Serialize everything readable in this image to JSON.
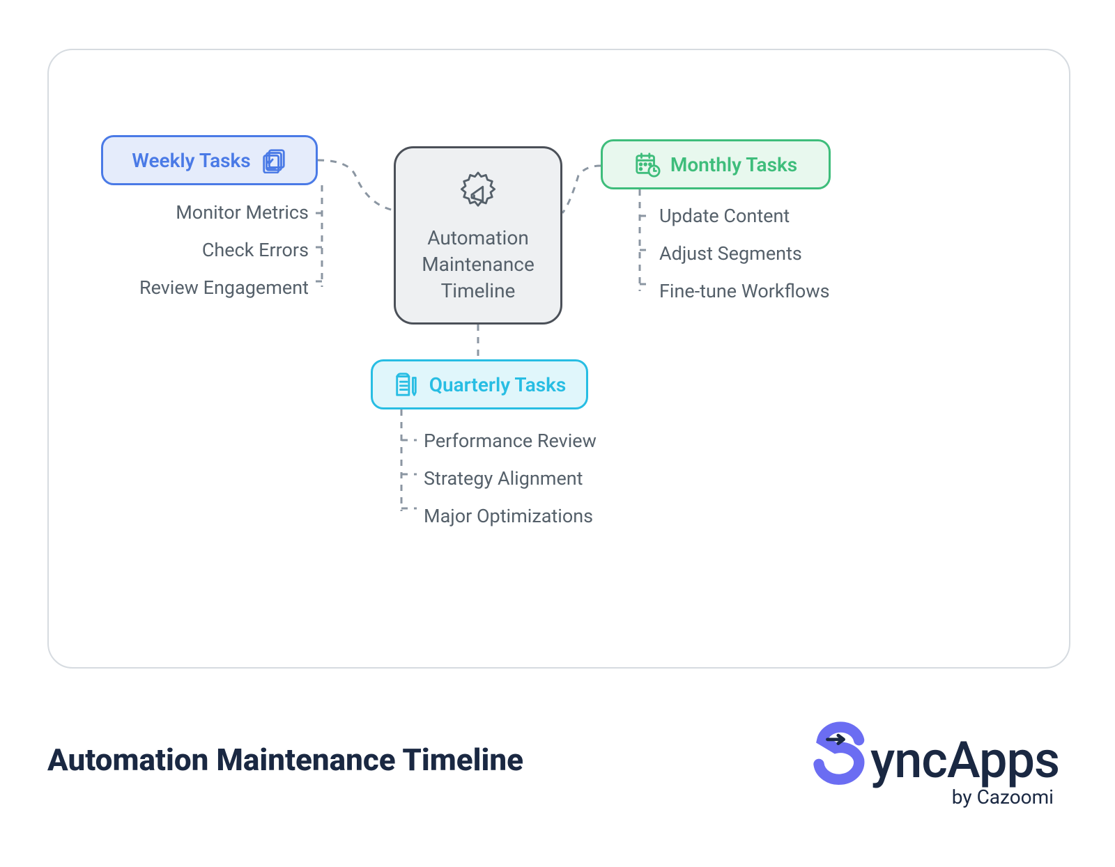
{
  "center": {
    "label": "Automation\nMaintenance\nTimeline"
  },
  "weekly": {
    "title": "Weekly Tasks",
    "items": [
      "Monitor Metrics",
      "Check Errors",
      "Review Engagement"
    ]
  },
  "monthly": {
    "title": "Monthly Tasks",
    "items": [
      "Update Content",
      "Adjust Segments",
      "Fine-tune Workflows"
    ]
  },
  "quarterly": {
    "title": "Quarterly Tasks",
    "items": [
      "Performance Review",
      "Strategy Alignment",
      "Major Optimizations"
    ]
  },
  "footer": {
    "title": "Automation Maintenance Timeline",
    "logo_text": "yncApps",
    "by": "by Cazoomi"
  },
  "colors": {
    "weekly": "#4a7ae6",
    "monthly": "#3ebd7b",
    "quarterly": "#27bde3",
    "text": "#55606a",
    "dark": "#1a2842",
    "purple": "#6b6df2"
  }
}
